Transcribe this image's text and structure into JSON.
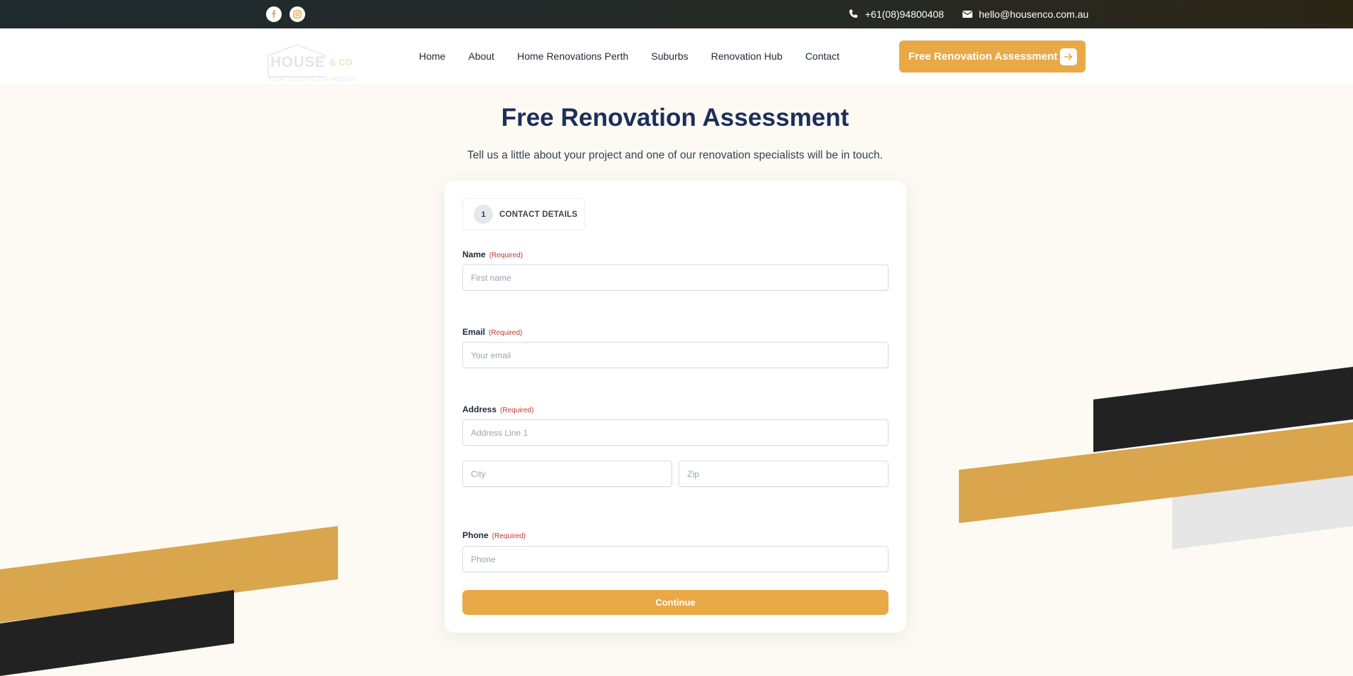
{
  "topbar": {
    "social": [
      {
        "name": "facebook-icon"
      },
      {
        "name": "instagram-icon"
      }
    ],
    "phone": "+61(08)94800408",
    "email": "hello@housenco.com.au"
  },
  "header": {
    "logo": {
      "word": "HOUSE",
      "amp": "& CO",
      "tagline": "YOUR VISION IS OUR MISSION"
    },
    "nav": [
      "Home",
      "About",
      "Home Renovations Perth",
      "Suburbs",
      "Renovation Hub",
      "Contact"
    ],
    "cta_label": "Free Renovation Assessment"
  },
  "main": {
    "title": "Free Renovation Assessment",
    "subtitle": "Tell us a little about your project and one of our renovation specialists will be in touch."
  },
  "form": {
    "step": {
      "number": "1",
      "label": "CONTACT DETAILS"
    },
    "required_text": "(Required)",
    "name": {
      "label": "Name",
      "placeholder": "First name",
      "value": ""
    },
    "email": {
      "label": "Email",
      "placeholder": "Your email",
      "value": ""
    },
    "address": {
      "label": "Address",
      "line1_placeholder": "Address Line 1",
      "city_placeholder": "City",
      "zip_placeholder": "Zip"
    },
    "phone": {
      "label": "Phone",
      "placeholder": "Phone",
      "value": ""
    },
    "continue_label": "Continue"
  },
  "colors": {
    "accent": "#e8a946",
    "title": "#1c2f5b",
    "background": "#fdfaf3",
    "dark_stripe": "#222222",
    "gold_stripe": "#d9a54d",
    "grey_stripe": "#e6e6e6"
  }
}
